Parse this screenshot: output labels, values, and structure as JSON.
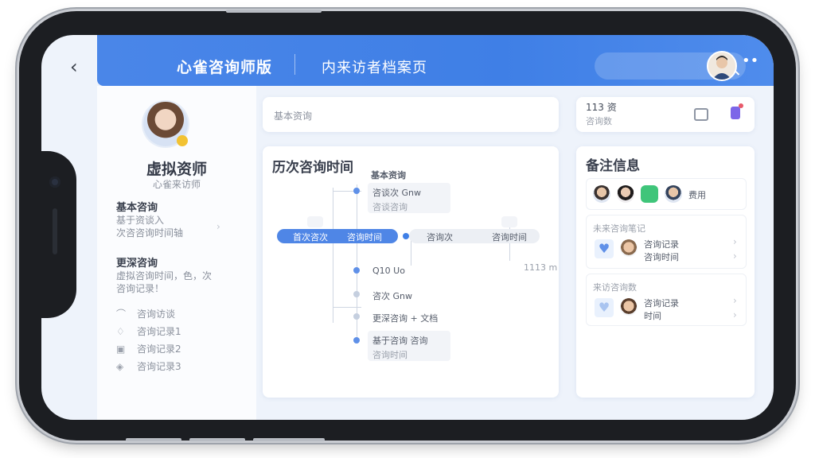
{
  "header": {
    "back_icon": "chevron-left-icon",
    "app_title": "心雀咨询师版",
    "page_title": "内来访者档案页",
    "search_icon": "search-icon",
    "more": "••",
    "accent_color": "#4a86e8"
  },
  "profile": {
    "name": "虚拟资师",
    "subtitle": "心雀来访师"
  },
  "left_sections": [
    {
      "title": "基本咨询",
      "lines": [
        "基于资谈入",
        "次咨咨询时间轴"
      ]
    },
    {
      "title": "更深咨询",
      "lines": [
        "虚拟咨询时间，色，次",
        "咨询记录！"
      ]
    }
  ],
  "left_menu": [
    {
      "icon": "headset-icon",
      "glyph": "⌒",
      "label": "咨询访谈"
    },
    {
      "icon": "gift-icon",
      "glyph": "♢",
      "label": "咨询记录1"
    },
    {
      "icon": "box-icon",
      "glyph": "▣",
      "label": "咨询记录2"
    },
    {
      "icon": "shield-icon",
      "glyph": "◈",
      "label": "咨询记录3"
    }
  ],
  "basic_card": {
    "label": "基本资询"
  },
  "history": {
    "title": "历次咨询时间",
    "top_label": "基本资询",
    "node1_title": "咨谈次 Gnw",
    "node1_sub": "咨谈咨询",
    "pill_blue_left": "首次咨次",
    "pill_blue_right": "咨询时间",
    "pill_grey_left": "咨询次",
    "pill_grey_right": "咨询时间",
    "right_tick": "1113 m",
    "n2": "Q10 Uo",
    "n3": "咨次 Gnw",
    "n4": "更深咨询 + 文档",
    "n5_title": "基于咨询 咨询",
    "n5_sub": "咨询时间"
  },
  "top_right": {
    "line1": "113 资",
    "line2": "咨询数",
    "chat_icon": "chat-icon",
    "app_icon": "notification-app-icon"
  },
  "notes": {
    "title": "备注信息",
    "avatars_label": "费用",
    "item1_title": "未来咨询笔记",
    "item1_line1": "咨询记录",
    "item1_line2": "咨询时间",
    "item2_title": "来访咨询数",
    "item2_line1": "咨询记录",
    "item2_line2": "时间"
  }
}
